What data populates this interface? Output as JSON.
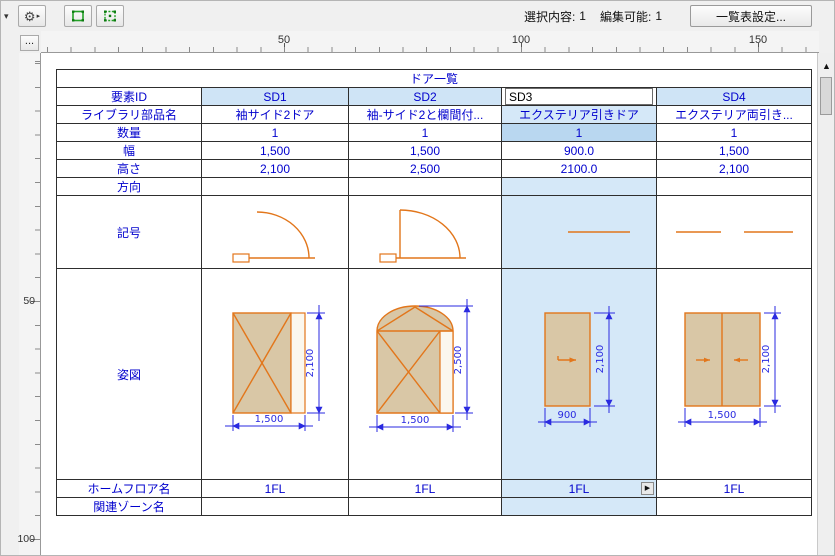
{
  "toolbar": {
    "selection_label": "選択内容:",
    "selection_count": "1",
    "editable_label": "編集可能:",
    "editable_count": "1",
    "settings_button": "一覧表設定..."
  },
  "icons": {
    "gear": "⚙",
    "dropdown_caret": "▾",
    "mini_caret": "▸",
    "scroll_up": "▲",
    "floor_popup": "▶",
    "corner_more": "..."
  },
  "colors": {
    "drawing_orange": "#e2761b",
    "fill_tan": "#d9c7a6",
    "dimension_blue": "#2a2ae0",
    "text_blue": "#0000cd",
    "selection_blue": "#d5e8f8"
  },
  "rulers": {
    "h_labels": [
      "50",
      "100",
      "150"
    ],
    "v_labels": [
      "50",
      "100"
    ]
  },
  "table": {
    "title": "ドア一覧",
    "row_labels": {
      "element_id": "要素ID",
      "library_part": "ライブラリ部品名",
      "quantity": "数量",
      "width": "幅",
      "height": "高さ",
      "direction": "方向",
      "symbol": "記号",
      "elevation": "姿図",
      "home_floor": "ホームフロア名",
      "zone": "関連ゾーン名"
    },
    "columns": [
      {
        "id": "SD1",
        "library": "袖サイド2ドア",
        "quantity": "1",
        "width": "1,500",
        "height": "2,100",
        "direction": "",
        "floor": "1FL",
        "zone": "",
        "dim_width": "1,500",
        "dim_height": "2,100"
      },
      {
        "id": "SD2",
        "library": "袖-サイド2と欄間付...",
        "quantity": "1",
        "width": "1,500",
        "height": "2,500",
        "direction": "",
        "floor": "1FL",
        "zone": "",
        "dim_width": "1,500",
        "dim_height": "2,500"
      },
      {
        "id": "SD3",
        "library": "エクステリア引きドア",
        "quantity": "1",
        "width": "900.0",
        "height": "2100.0",
        "direction": "",
        "floor": "1FL",
        "zone": "",
        "dim_width": "900",
        "dim_height": "2,100"
      },
      {
        "id": "SD4",
        "library": "エクステリア両引き...",
        "quantity": "1",
        "width": "1,500",
        "height": "2,100",
        "direction": "",
        "floor": "1FL",
        "zone": "",
        "dim_width": "1,500",
        "dim_height": "2,100"
      }
    ]
  }
}
